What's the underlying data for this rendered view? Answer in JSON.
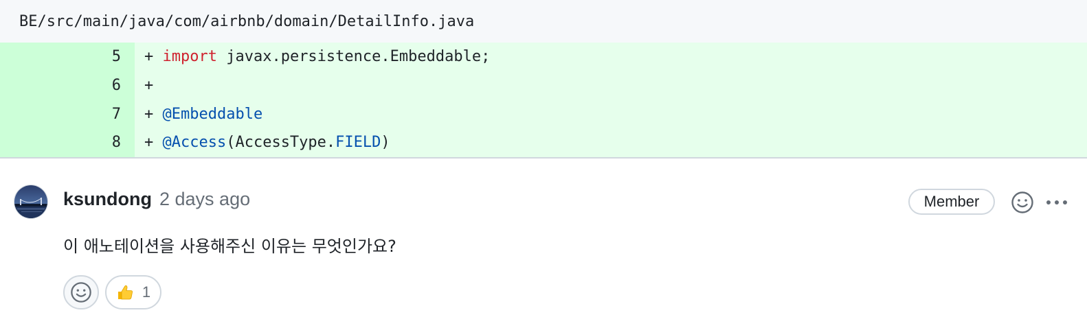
{
  "file": {
    "path": "BE/src/main/java/com/airbnb/domain/DetailInfo.java"
  },
  "diff": {
    "lines": [
      {
        "number": "5",
        "prefix": "+ ",
        "tokens": [
          "import",
          " javax.persistence.Embeddable;"
        ]
      },
      {
        "number": "6",
        "prefix": "+",
        "tokens": []
      },
      {
        "number": "7",
        "prefix": "+ ",
        "tokens": [
          "@Embeddable"
        ]
      },
      {
        "number": "8",
        "prefix": "+ ",
        "tokens": [
          "@Access",
          "(AccessType.",
          "FIELD",
          ")"
        ]
      }
    ],
    "colors": {
      "added_bg": "#e6ffec",
      "added_num_bg": "#ccffd8",
      "keyword": "#cf222e",
      "annotation": "#0550ae"
    }
  },
  "comment": {
    "author": "ksundong",
    "timestamp": "2 days ago",
    "role_badge": "Member",
    "body": "이 애노테이션을 사용해주신 이유는 무엇인가요?",
    "reactions": [
      {
        "emoji": "thumbs-up",
        "count": "1"
      }
    ]
  }
}
